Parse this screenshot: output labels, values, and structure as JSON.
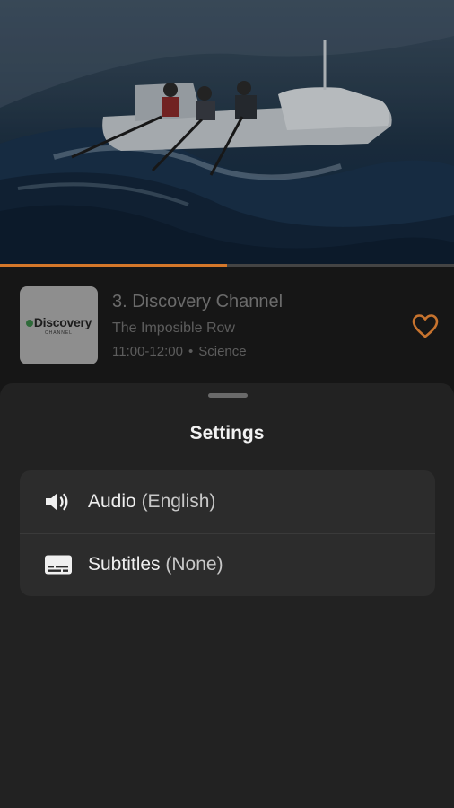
{
  "player": {
    "progress_fraction": 0.5,
    "accent_color": "#d4772a"
  },
  "program": {
    "logo_text": "Discovery",
    "logo_subtext": "CHANNEL",
    "channel_title": "3. Discovery Channel",
    "show_title": "The Imposible Row",
    "time_range": "11:00-12:00",
    "separator": "•",
    "genre": "Science",
    "favorite_icon": "heart-outline-icon"
  },
  "settings": {
    "title": "Settings",
    "options": [
      {
        "icon": "speaker-icon",
        "label": "Audio",
        "value": "(English)"
      },
      {
        "icon": "subtitles-icon",
        "label": "Subtitles",
        "value": "(None)"
      }
    ]
  }
}
